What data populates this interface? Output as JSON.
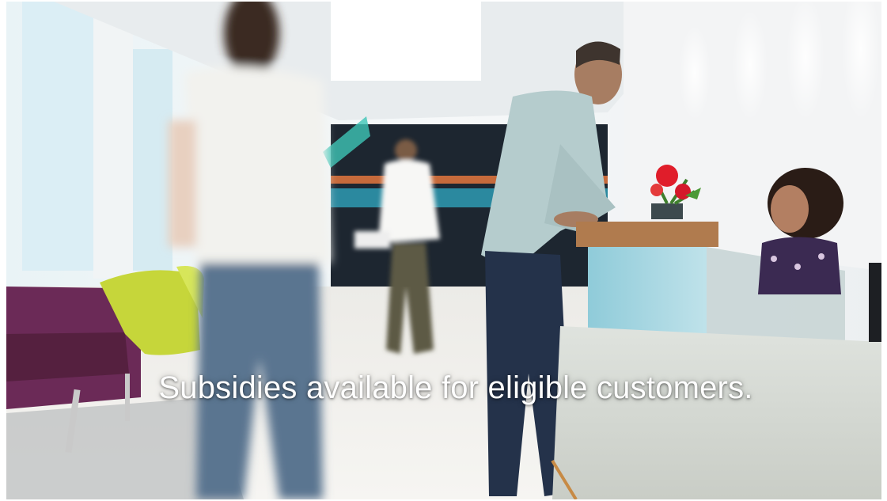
{
  "banner": {
    "caption": "Subsidies available for eligible customers.",
    "image_description_icon": "office-reception-photo"
  },
  "colors": {
    "caption_text": "#ffffff",
    "wall": "#eef2f4",
    "sofa": "#6b2a57",
    "chair": "#c6d63a",
    "counter_glass": "#a9d8e2",
    "counter_wood": "#b07b4e",
    "flowers": "#e01d2a"
  }
}
